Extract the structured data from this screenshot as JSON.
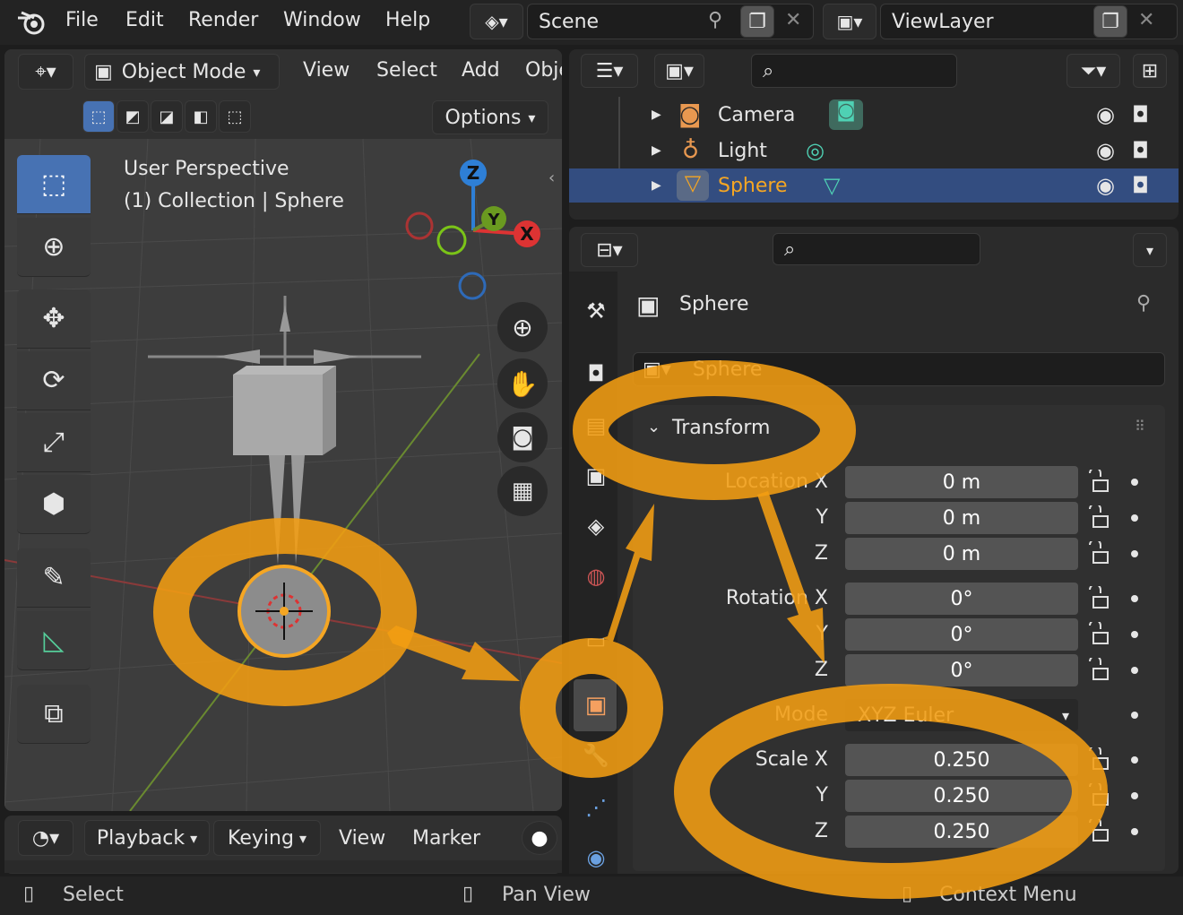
{
  "topbar": {
    "menus": [
      "File",
      "Edit",
      "Render",
      "Window",
      "Help"
    ],
    "scene_label": "Scene",
    "viewlayer_label": "ViewLayer"
  },
  "viewport": {
    "mode": "Object Mode",
    "menus": [
      "View",
      "Select",
      "Add",
      "Obje"
    ],
    "options_label": "Options",
    "info_line1": "User Perspective",
    "info_line2": "(1) Collection | Sphere",
    "gizmo": {
      "z": "Z",
      "y": "Y",
      "x": "X"
    }
  },
  "outliner": {
    "items": [
      {
        "label": "Camera",
        "color": "#e6e6e6"
      },
      {
        "label": "Light",
        "color": "#e6e6e6"
      },
      {
        "label": "Sphere",
        "color": "#f5a623",
        "selected": true
      }
    ]
  },
  "properties": {
    "object_name": "Sphere",
    "data_name": "Sphere",
    "panel_title": "Transform",
    "location": {
      "label": "Location X",
      "y": "Y",
      "z": "Z",
      "values": [
        "0 m",
        "0 m",
        "0 m"
      ]
    },
    "rotation": {
      "label": "Rotation X",
      "y": "Y",
      "z": "Z",
      "values": [
        "0°",
        "0°",
        "0°"
      ]
    },
    "mode": {
      "label": "Mode",
      "value": "XYZ Euler"
    },
    "scale": {
      "label": "Scale X",
      "y": "Y",
      "z": "Z",
      "values": [
        "0.250",
        "0.250",
        "0.250"
      ]
    }
  },
  "timeline": {
    "menus": [
      "Playback",
      "Keying",
      "View",
      "Marker"
    ]
  },
  "statusbar": {
    "select": "Select",
    "pan": "Pan View",
    "context": "Context Menu"
  },
  "colors": {
    "accent_blue": "#4772b3",
    "annotation_orange": "#f29d12",
    "selection_orange": "#f5a623"
  }
}
